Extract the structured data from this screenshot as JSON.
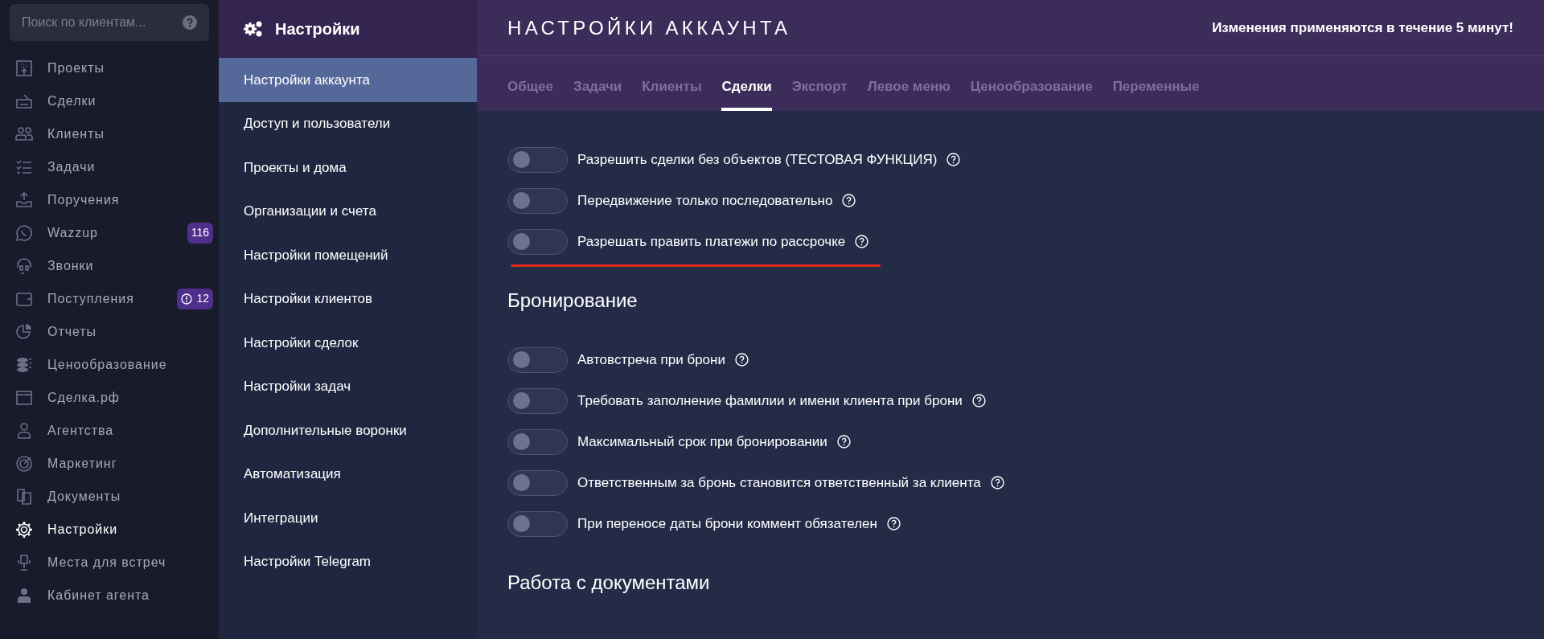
{
  "search": {
    "placeholder": "Поиск по клиентам..."
  },
  "nav": [
    {
      "label": "Проекты",
      "selected": false
    },
    {
      "label": "Сделки",
      "selected": false
    },
    {
      "label": "Клиенты",
      "selected": false
    },
    {
      "label": "Задачи",
      "selected": false
    },
    {
      "label": "Поручения",
      "selected": false
    },
    {
      "label": "Wazzup",
      "selected": false,
      "badge": "116",
      "badge_alert": false
    },
    {
      "label": "Звонки",
      "selected": false
    },
    {
      "label": "Поступления",
      "selected": false,
      "badge": "12",
      "badge_alert": true
    },
    {
      "label": "Отчеты",
      "selected": false
    },
    {
      "label": "Ценообразование",
      "selected": false
    },
    {
      "label": "Сделка.рф",
      "selected": false
    },
    {
      "label": "Агентства",
      "selected": false
    },
    {
      "label": "Маркетинг",
      "selected": false
    },
    {
      "label": "Документы",
      "selected": false
    },
    {
      "label": "Настройки",
      "selected": true
    },
    {
      "label": "Места для встреч",
      "selected": false
    },
    {
      "label": "Кабинет агента",
      "selected": false
    }
  ],
  "settings_menu": {
    "title": "Настройки",
    "items": [
      {
        "label": "Настройки аккаунта",
        "selected": true
      },
      {
        "label": "Доступ и пользователи",
        "selected": false
      },
      {
        "label": "Проекты и дома",
        "selected": false
      },
      {
        "label": "Организации и счета",
        "selected": false
      },
      {
        "label": "Настройки помещений",
        "selected": false
      },
      {
        "label": "Настройки клиентов",
        "selected": false
      },
      {
        "label": "Настройки сделок",
        "selected": false
      },
      {
        "label": "Настройки задач",
        "selected": false
      },
      {
        "label": "Дополнительные воронки",
        "selected": false
      },
      {
        "label": "Автоматизация",
        "selected": false
      },
      {
        "label": "Интеграции",
        "selected": false
      },
      {
        "label": "Настройки Telegram",
        "selected": false
      }
    ]
  },
  "page": {
    "title": "НАСТРОЙКИ АККАУНТА",
    "notice": "Изменения применяются в течение 5 минут!"
  },
  "tabs": [
    {
      "label": "Общее",
      "selected": false
    },
    {
      "label": "Задачи",
      "selected": false
    },
    {
      "label": "Клиенты",
      "selected": false
    },
    {
      "label": "Сделки",
      "selected": true
    },
    {
      "label": "Экспорт",
      "selected": false
    },
    {
      "label": "Левое меню",
      "selected": false
    },
    {
      "label": "Ценообразование",
      "selected": false
    },
    {
      "label": "Переменные",
      "selected": false
    }
  ],
  "sections": [
    {
      "toggles": [
        {
          "label": "Разрешить сделки без объектов (ТЕСТОВАЯ ФУНКЦИЯ)",
          "on": false,
          "underlined": false
        },
        {
          "label": "Передвижение только последовательно",
          "on": false,
          "underlined": false
        },
        {
          "label": "Разрешать править платежи по рассрочке",
          "on": false,
          "underlined": true
        }
      ]
    },
    {
      "title": "Бронирование",
      "toggles": [
        {
          "label": "Автовстреча при брони",
          "on": false,
          "underlined": false
        },
        {
          "label": "Требовать заполнение фамилии и имени клиента при брони",
          "on": false,
          "underlined": false
        },
        {
          "label": "Максимальный срок при бронировании",
          "on": false,
          "underlined": false
        },
        {
          "label": "Ответственным за бронь становится ответственный за клиента",
          "on": false,
          "underlined": false
        },
        {
          "label": "При переносе даты брони коммент обязателен",
          "on": false,
          "underlined": false
        }
      ]
    },
    {
      "title": "Работа с документами"
    }
  ]
}
